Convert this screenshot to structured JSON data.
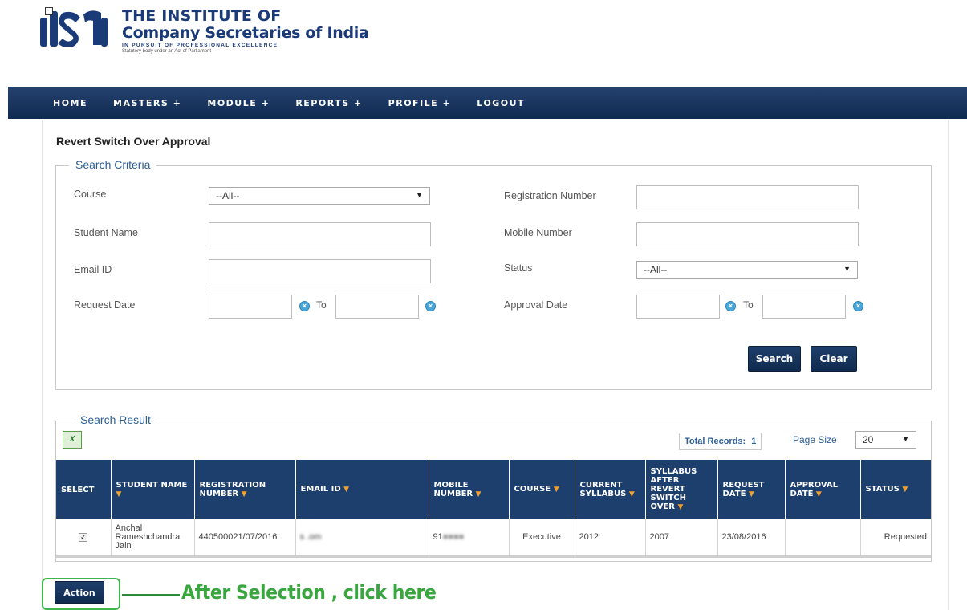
{
  "header": {
    "title_line1": "THE INSTITUTE OF",
    "title_line2": "Company Secretaries of India",
    "tagline": "IN PURSUIT OF PROFESSIONAL EXCELLENCE",
    "subline": "Statutory body under an Act of Parliament",
    "logo_text": "ICSI"
  },
  "nav": {
    "items": [
      {
        "label": "HOME"
      },
      {
        "label": "MASTERS +"
      },
      {
        "label": "MODULE +"
      },
      {
        "label": "REPORTS +"
      },
      {
        "label": "PROFILE +"
      },
      {
        "label": "LOGOUT"
      }
    ]
  },
  "page": {
    "title": "Revert Switch Over Approval"
  },
  "search": {
    "legend": "Search Criteria",
    "course_label": "Course",
    "course_value": "--All--",
    "registration_label": "Registration Number",
    "student_label": "Student Name",
    "mobile_label": "Mobile Number",
    "email_label": "Email ID",
    "status_label": "Status",
    "status_value": "--All--",
    "request_date_label": "Request Date",
    "approval_date_label": "Approval Date",
    "to_label": "To",
    "search_button": "Search",
    "clear_button": "Clear"
  },
  "result": {
    "legend": "Search Result",
    "excel_icon": "X",
    "total_label": "Total Records:",
    "total_value": "1",
    "page_size_label": "Page Size",
    "page_size_value": "20",
    "columns": [
      {
        "label": "SELECT",
        "sortable": false
      },
      {
        "label": "STUDENT NAME",
        "sortable": true
      },
      {
        "label": "REGISTRATION NUMBER",
        "sortable": true
      },
      {
        "label": "EMAIL ID",
        "sortable": true
      },
      {
        "label": "MOBILE NUMBER",
        "sortable": true
      },
      {
        "label": "COURSE",
        "sortable": true
      },
      {
        "label": "CURRENT SYLLABUS",
        "sortable": true
      },
      {
        "label": "SYLLABUS AFTER REVERT SWITCH OVER",
        "sortable": true
      },
      {
        "label": "REQUEST DATE",
        "sortable": true
      },
      {
        "label": "APPROVAL DATE",
        "sortable": true
      },
      {
        "label": "STATUS",
        "sortable": true
      }
    ],
    "rows": [
      {
        "selected": "✓",
        "student_name": "Anchal Rameshchandra Jain",
        "registration_number": "440500021/07/2016",
        "email": "s            .om",
        "mobile": "91",
        "course": "Executive",
        "current_syllabus": "2012",
        "syllabus_after": "2007",
        "request_date": "23/08/2016",
        "approval_date": "",
        "status": "Requested"
      }
    ]
  },
  "action": {
    "button": "Action",
    "annotation": "After Selection , click here"
  },
  "colors": {
    "nav_bg": "#1d3f6d",
    "brand_blue": "#1a3a78",
    "annotation_green": "#3aa63f",
    "sort_arrow": "#f0a030"
  }
}
